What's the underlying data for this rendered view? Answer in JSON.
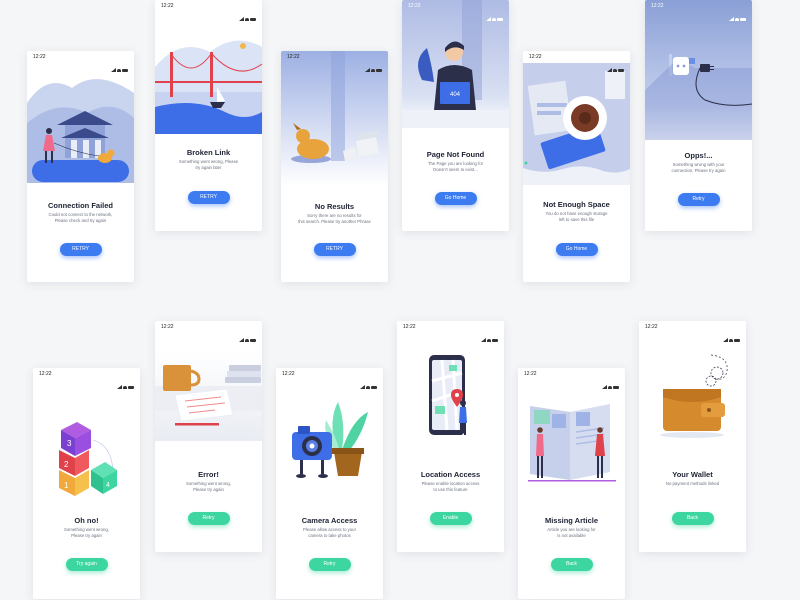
{
  "status_time": "12:22",
  "screens": [
    {
      "id": "connection-failed",
      "title": "Connection Failed",
      "desc": [
        "Could not connect to the network,",
        "Please check and try again"
      ],
      "button": "RETRY"
    },
    {
      "id": "broken-link",
      "title": "Broken Link",
      "desc": [
        "Something went wrong, Please",
        "try again later"
      ],
      "button": "RETRY"
    },
    {
      "id": "no-results",
      "title": "No Results",
      "desc": [
        "Sorry there are no results for",
        "this search. Please try another Phrase"
      ],
      "button": "RETRY"
    },
    {
      "id": "page-not-found",
      "title": "Page Not Found",
      "desc": [
        "The Page you are looking for",
        "Doesn't seem to exist..."
      ],
      "button": "Go Home",
      "illus_text": "404"
    },
    {
      "id": "not-enough-space",
      "title": "Not Enough Space",
      "desc": [
        "You do not have enough storage",
        "left to save this file"
      ],
      "button": "Go Home"
    },
    {
      "id": "opps",
      "title": "Opps!...",
      "desc": [
        "Something wrong with your",
        "connection, Please try again"
      ],
      "button": "Retry"
    },
    {
      "id": "oh-no",
      "title": "Oh no!",
      "desc": [
        "Something went wrong,",
        "Please try again"
      ],
      "button": "Try again",
      "cube_numbers": [
        "3",
        "2",
        "1",
        "4"
      ]
    },
    {
      "id": "error",
      "title": "Error!",
      "desc": [
        "Something went wrong,",
        "Please try again"
      ],
      "button": "Retry"
    },
    {
      "id": "camera-access",
      "title": "Camera Access",
      "desc": [
        "Please allow access to your",
        "camera to take photos"
      ],
      "button": "Retry"
    },
    {
      "id": "location-access",
      "title": "Location Access",
      "desc": [
        "Please enable location access",
        "to use this feature"
      ],
      "button": "Enable"
    },
    {
      "id": "missing-article",
      "title": "Missing Article",
      "desc": [
        "Article you are looking for",
        "is not available"
      ],
      "button": "Back"
    },
    {
      "id": "your-wallet",
      "title": "Your Wallet",
      "desc": [
        "No payment methods linked"
      ],
      "button": "Back"
    }
  ],
  "colors": {
    "primary_blue": "#3d7bf0",
    "primary_green": "#3dd6a0",
    "title": "#1d2233",
    "text_muted": "#6b7280",
    "background": "#f5f6f8"
  },
  "icons": [
    "signal-icon",
    "wifi-icon",
    "battery-icon"
  ]
}
